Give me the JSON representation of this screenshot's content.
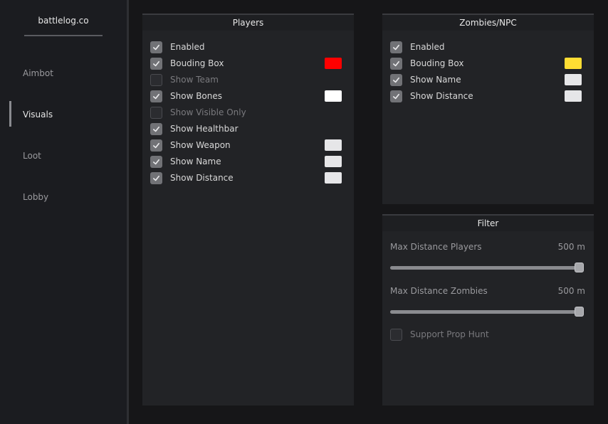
{
  "sidebar": {
    "brand": "battlelog.co",
    "items": [
      {
        "label": "Aimbot",
        "active": false
      },
      {
        "label": "Visuals",
        "active": true
      },
      {
        "label": "Loot",
        "active": false
      },
      {
        "label": "Lobby",
        "active": false
      }
    ]
  },
  "players": {
    "title": "Players",
    "options": [
      {
        "label": "Enabled",
        "checked": true
      },
      {
        "label": "Bouding Box",
        "checked": true,
        "color": "#ff0000"
      },
      {
        "label": "Show Team",
        "checked": false
      },
      {
        "label": "Show Bones",
        "checked": true,
        "color": "#ffffff"
      },
      {
        "label": "Show Visible Only",
        "checked": false
      },
      {
        "label": "Show Healthbar",
        "checked": true
      },
      {
        "label": "Show Weapon",
        "checked": true,
        "color": "#e6e6e8"
      },
      {
        "label": "Show Name",
        "checked": true,
        "color": "#e6e6e8"
      },
      {
        "label": "Show Distance",
        "checked": true,
        "color": "#e6e6e8"
      }
    ]
  },
  "zombies": {
    "title": "Zombies/NPC",
    "options": [
      {
        "label": "Enabled",
        "checked": true
      },
      {
        "label": "Bouding Box",
        "checked": true,
        "color": "#ffdd33"
      },
      {
        "label": "Show Name",
        "checked": true,
        "color": "#e6e6e8"
      },
      {
        "label": "Show Distance",
        "checked": true,
        "color": "#e6e6e8"
      }
    ]
  },
  "filter": {
    "title": "Filter",
    "sliders": [
      {
        "label": "Max Distance Players",
        "value": "500 m",
        "fraction": 1.0
      },
      {
        "label": "Max Distance Zombies",
        "value": "500 m",
        "fraction": 1.0
      }
    ],
    "prop_hunt": {
      "label": "Support Prop Hunt",
      "checked": false
    }
  }
}
